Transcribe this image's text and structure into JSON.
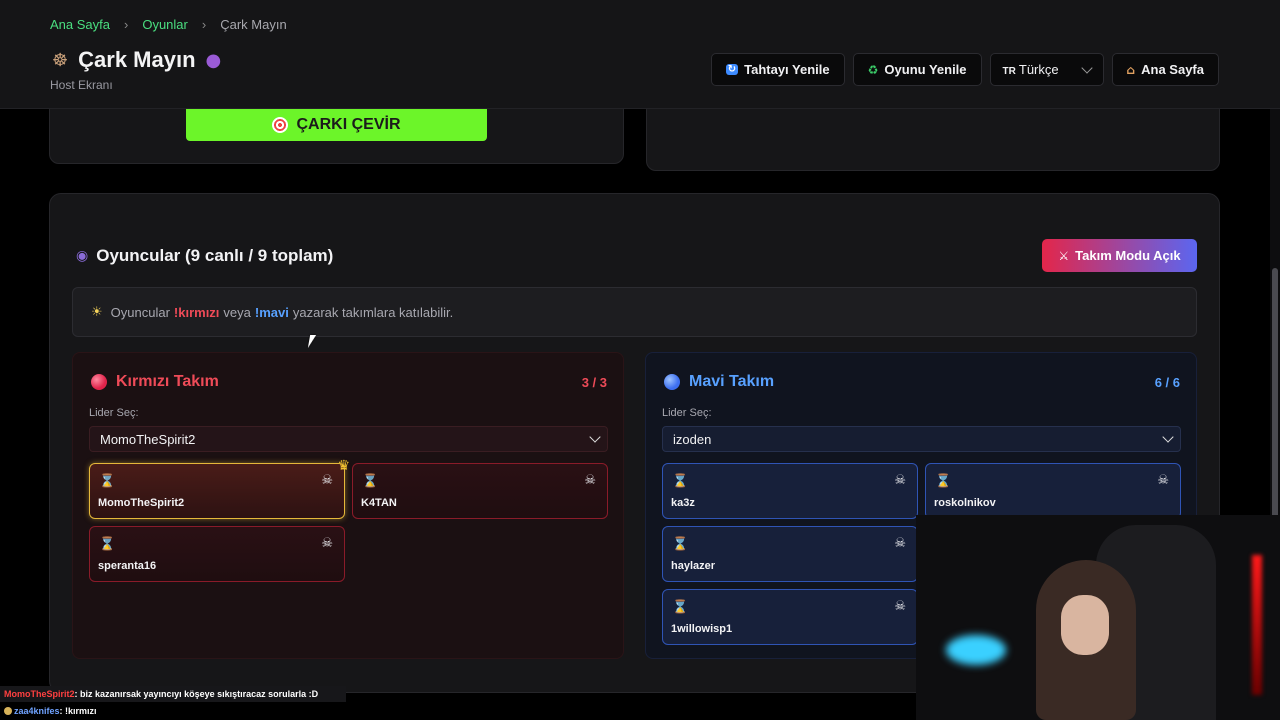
{
  "breadcrumb": {
    "home": "Ana Sayfa",
    "games": "Oyunlar",
    "current": "Çark Mayın"
  },
  "header": {
    "title": "Çark Mayın",
    "subtitle": "Host Ekranı",
    "title_icon_left": "ferris-wheel-icon",
    "title_icon_right": "bomb-icon",
    "buttons": {
      "refresh_board": "Tahtayı Yenile",
      "restart_game": "Oyunu Yenile",
      "language_flag": "TR",
      "language": "Türkçe",
      "home": "Ana Sayfa"
    }
  },
  "spin": {
    "label": "ÇARKI ÇEVİR",
    "color": "#6cf529"
  },
  "players": {
    "title": "Oyuncular (9 canlı / 9 toplam)",
    "team_mode_label": "Takım Modu Açık",
    "info": {
      "prefix": "Oyuncular",
      "red_cmd": "!kırmızı",
      "mid": "veya",
      "blue_cmd": "!mavi",
      "suffix": "yazarak takımlara katılabilir."
    }
  },
  "teams": {
    "red": {
      "name": "Kırmızı Takım",
      "count": "3 / 3",
      "leader_label": "Lider Seç:",
      "leader": "MomoTheSpirit2",
      "color": "#ef4b58",
      "players": [
        "MomoTheSpirit2",
        "K4TAN",
        "speranta16"
      ]
    },
    "blue": {
      "name": "Mavi Takım",
      "count": "6 / 6",
      "leader_label": "Lider Seç:",
      "leader": "izoden",
      "color": "#58a1ff",
      "players": [
        "ka3z",
        "roskolnikov",
        "haylazer",
        "1willowisp1"
      ]
    }
  },
  "chat": [
    {
      "user": "MomoTheSpirit2",
      "message": ": biz kazanırsak yayıncıyı köşeye sıkıştıracaz sorularla :D"
    },
    {
      "user": "zaa4knifes",
      "message": ": !kırmızı"
    }
  ]
}
